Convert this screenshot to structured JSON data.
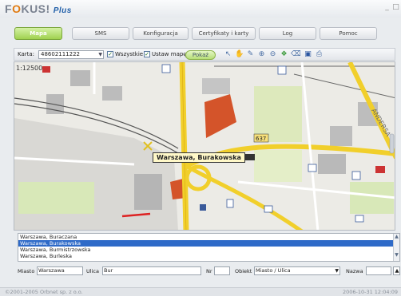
{
  "app": {
    "brand_prefix": "F",
    "brand_o": "O",
    "brand_suffix": "KUS!",
    "brand_plus": "Plus",
    "minimize": "_",
    "maximize": "□"
  },
  "tabs": [
    {
      "label": "Mapa",
      "active": true
    },
    {
      "label": "SMS",
      "active": false
    },
    {
      "label": "Konfiguracja",
      "active": false
    },
    {
      "label": "Certyfikaty i karty",
      "active": false
    },
    {
      "label": "Log",
      "active": false
    },
    {
      "label": "Pomoc",
      "active": false
    }
  ],
  "toolbar": {
    "card_label": "Karta:",
    "card_value": "48602111222",
    "all_label": "Wszystkie",
    "all_checked": true,
    "set_map_label": "Ustaw mapę",
    "set_map_checked": true,
    "show_button": "Pokaż",
    "tools": [
      "cursor-icon",
      "hand-icon",
      "pencil-icon",
      "zoom-in-icon",
      "zoom-out-icon",
      "layers-icon",
      "eraser-icon",
      "save-icon",
      "print-icon"
    ]
  },
  "map": {
    "scale": "1:12500",
    "tooltip": "Warszawa, Burakowska",
    "road_number": "637",
    "street_label_right": "ANDERSA"
  },
  "results": {
    "items": [
      {
        "label": "Warszawa, Buraczana",
        "selected": false
      },
      {
        "label": "Warszawa, Burakowska",
        "selected": true
      },
      {
        "label": "Warszawa, Burmistrzowska",
        "selected": false
      },
      {
        "label": "Warszawa, Burleska",
        "selected": false
      }
    ]
  },
  "search": {
    "city_label": "Miasto",
    "city_value": "Warszawa",
    "street_label": "Ulica",
    "street_value": "Bur",
    "number_label": "Nr",
    "number_value": "",
    "object_label": "Obiekt",
    "object_value": "Miasto / Ulica",
    "name_label": "Nazwa",
    "name_value": ""
  },
  "status": {
    "left": "©2001-2005 Orbnet sp. z o.o.",
    "right": "2006-10-31 12:04:09"
  },
  "colors": {
    "accent_green": "#9fd14f",
    "road_yellow": "#f1cf2b",
    "building_red": "#d4542a",
    "selection_blue": "#2e6ac8"
  }
}
